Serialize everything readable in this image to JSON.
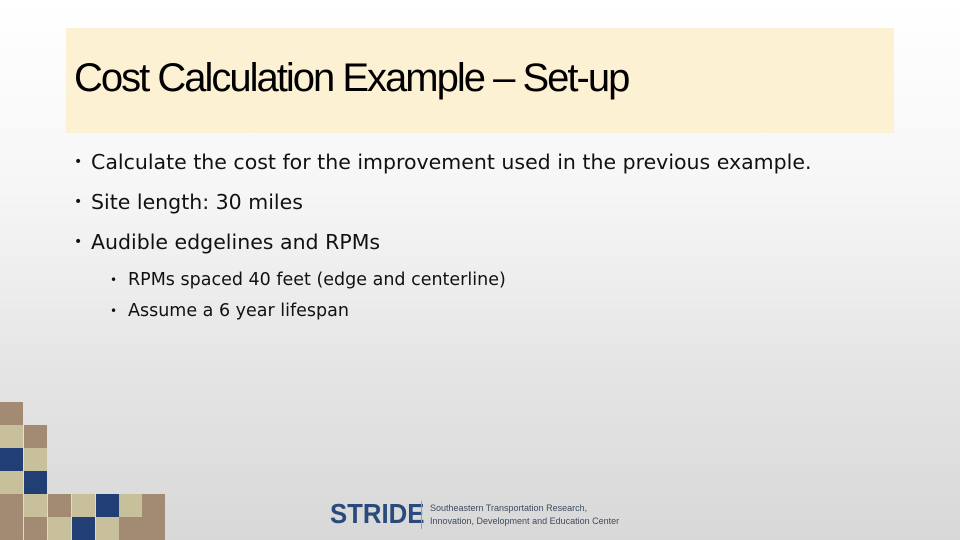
{
  "slide": {
    "title": "Cost Calculation Example – Set-up",
    "bullets": [
      {
        "level": 1,
        "text": "Calculate the cost for the improvement used in the previous example."
      },
      {
        "level": 1,
        "text": "Site length: 30 miles"
      },
      {
        "level": 1,
        "text": "Audible edgelines and RPMs"
      },
      {
        "level": 2,
        "text": "RPMs spaced 40 feet (edge and centerline)"
      },
      {
        "level": 2,
        "text": "Assume a 6 year lifespan"
      }
    ],
    "bullet_glyph": "•"
  },
  "logo": {
    "name": "STRIDE",
    "subtitle_line1": "Southeastern Transportation Research,",
    "subtitle_line2": "Innovation, Development and Education Center"
  },
  "colors": {
    "title_band": "#fdf1d3",
    "mosaic_brown": "#a38a73",
    "mosaic_tan": "#c8bf9b",
    "mosaic_blue": "#223f75",
    "logo_blue": "#2b4a7c"
  }
}
